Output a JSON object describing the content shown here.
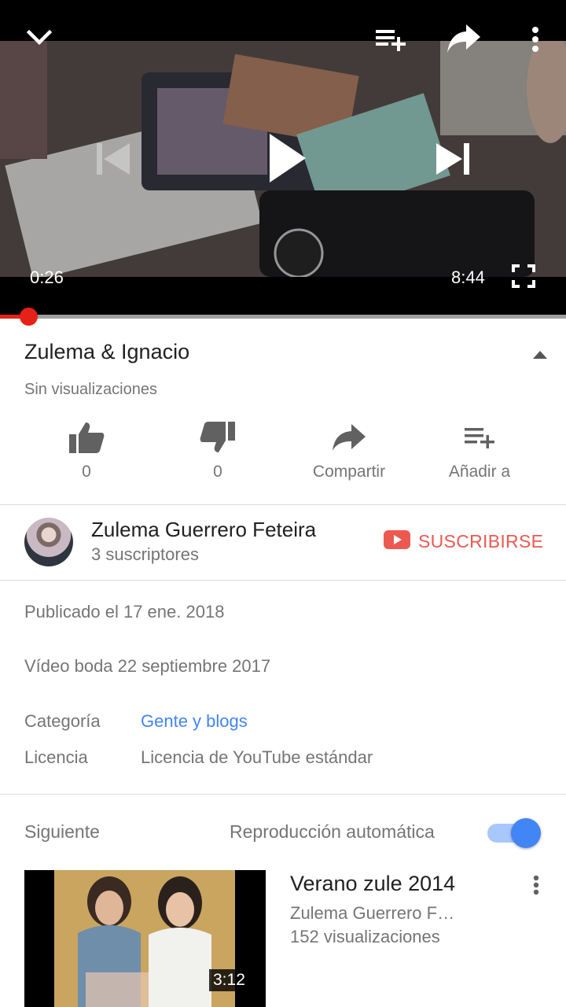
{
  "player": {
    "current_time": "0:26",
    "duration": "8:44",
    "progress_fraction": 0.05,
    "icons": {
      "collapse": "chevron-down-icon",
      "add_to_playlist": "playlist-add-icon",
      "share": "share-icon",
      "more": "more-vert-icon",
      "previous": "skip-previous-icon",
      "play": "play-icon",
      "next": "skip-next-icon",
      "fullscreen": "fullscreen-icon"
    }
  },
  "video": {
    "title": "Zulema & Ignacio",
    "views": "Sin visualizaciones",
    "actions": [
      {
        "icon": "thumb-up-icon",
        "label": "0"
      },
      {
        "icon": "thumb-down-icon",
        "label": "0"
      },
      {
        "icon": "share-icon",
        "label": "Compartir"
      },
      {
        "icon": "playlist-add-icon",
        "label": "Añadir a"
      }
    ]
  },
  "channel": {
    "name": "Zulema Guerrero Feteira",
    "subscribers": "3 suscriptores",
    "subscribe_label": "SUSCRIBIRSE"
  },
  "description": {
    "published": "Publicado el 17 ene. 2018",
    "text": "Vídeo boda 22 septiembre 2017",
    "category_label": "Categoría",
    "category_value": "Gente y blogs",
    "license_label": "Licencia",
    "license_value": "Licencia de YouTube estándar"
  },
  "next": {
    "label": "Siguiente",
    "autoplay_label": "Reproducción automática",
    "autoplay_on": true
  },
  "recommended": [
    {
      "title": "Verano zule 2014",
      "channel": "Zulema Guerrero Feteira",
      "views": "152 visualizaciones",
      "duration": "3:12"
    }
  ],
  "colors": {
    "accent_red": "#e62117",
    "link_blue": "#4285f4",
    "secondary_text": "#757575"
  }
}
